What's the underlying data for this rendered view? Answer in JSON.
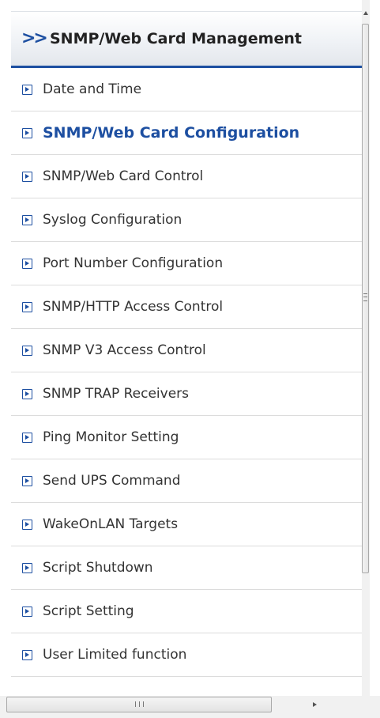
{
  "header": {
    "chevron_icon": "double-chevron-right-icon",
    "title": "SNMP/Web Card Management"
  },
  "menu": {
    "item_icon": "expand-box-icon",
    "active_index": 1,
    "items": [
      {
        "label": "Date and Time"
      },
      {
        "label": "SNMP/Web Card Configuration"
      },
      {
        "label": "SNMP/Web Card Control"
      },
      {
        "label": "Syslog Configuration"
      },
      {
        "label": "Port Number Configuration"
      },
      {
        "label": "SNMP/HTTP Access Control"
      },
      {
        "label": "SNMP V3 Access Control"
      },
      {
        "label": "SNMP TRAP Receivers"
      },
      {
        "label": "Ping Monitor Setting"
      },
      {
        "label": "Send UPS Command"
      },
      {
        "label": "WakeOnLAN Targets"
      },
      {
        "label": "Script Shutdown"
      },
      {
        "label": "Script Setting"
      },
      {
        "label": "User Limited function"
      }
    ]
  },
  "colors": {
    "accent": "#1d4fa1",
    "text": "#333333",
    "separator": "#dcdcdc"
  }
}
